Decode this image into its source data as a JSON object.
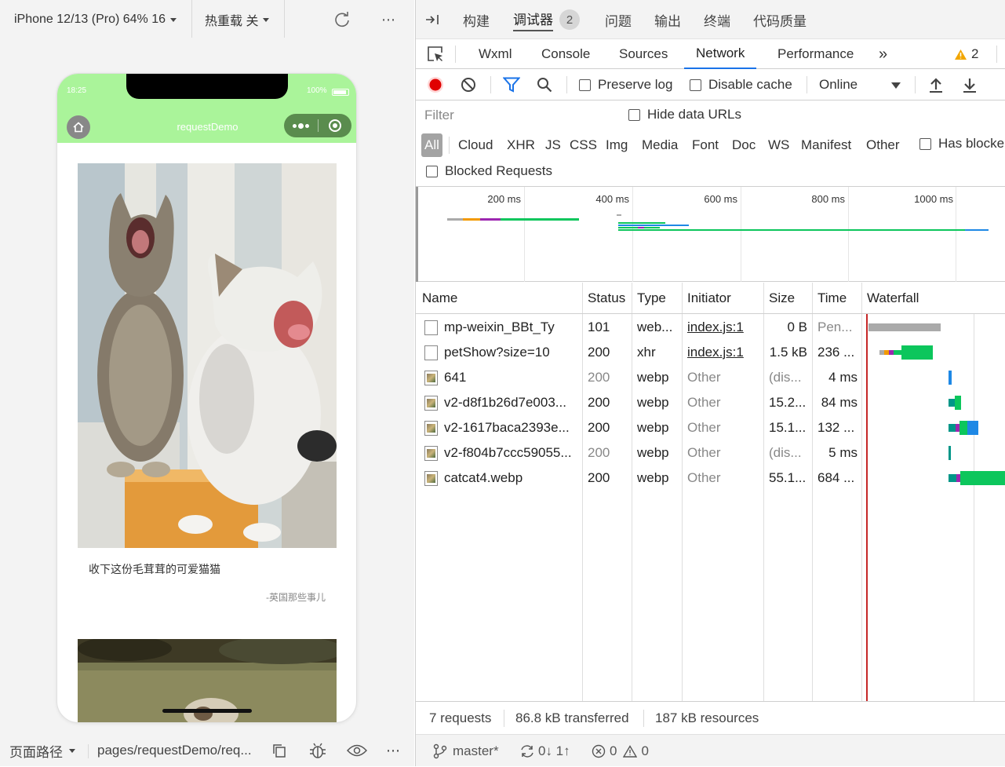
{
  "simulator": {
    "device": "iPhone 12/13 (Pro) 64% 16",
    "hot_reload": "热重载 关",
    "status_time": "18:25",
    "status_battery": "100%",
    "nav_title": "requestDemo",
    "card": {
      "title": "收下这份毛茸茸的可爱猫猫",
      "author": "-英国那些事儿"
    },
    "bottom": {
      "path_label": "页面路径",
      "path_value": "pages/requestDemo/req..."
    }
  },
  "devtools": {
    "top_tabs": [
      "构建",
      "调试器",
      "问题",
      "输出",
      "终端",
      "代码质量"
    ],
    "debugger_badge": "2",
    "panel_tabs": [
      "Wxml",
      "Console",
      "Sources",
      "Network",
      "Performance"
    ],
    "active_panel": "Network",
    "more_tabs": "»",
    "warnings_count": "2",
    "toolbar": {
      "preserve_log": "Preserve log",
      "disable_cache": "Disable cache",
      "throttle": "Online"
    },
    "filter": {
      "placeholder": "Filter",
      "hide_data_urls": "Hide data URLs",
      "types": [
        "All",
        "Cloud",
        "XHR",
        "JS",
        "CSS",
        "Img",
        "Media",
        "Font",
        "Doc",
        "WS",
        "Manifest",
        "Other"
      ],
      "has_blocked": "Has blocke",
      "blocked_requests": "Blocked Requests"
    },
    "overview_ticks": [
      "200 ms",
      "400 ms",
      "600 ms",
      "800 ms",
      "1000 ms"
    ],
    "columns": [
      "Name",
      "Status",
      "Type",
      "Initiator",
      "Size",
      "Time",
      "Waterfall"
    ],
    "requests": [
      {
        "name": "mp-weixin_BBt_Ty",
        "status": "101",
        "type": "web...",
        "initiator": "index.js:1",
        "size": "0 B",
        "time": "Pen...",
        "icon": "blank-doc-icon"
      },
      {
        "name": "petShow?size=10",
        "status": "200",
        "type": "xhr",
        "initiator": "index.js:1",
        "size": "1.5 kB",
        "time": "236 ...",
        "icon": "blank-doc-icon"
      },
      {
        "name": "641",
        "status": "200",
        "type": "webp",
        "initiator": "Other",
        "size": "(dis...",
        "time": "4 ms",
        "icon": "image-thumb-icon"
      },
      {
        "name": "v2-d8f1b26d7e003...",
        "status": "200",
        "type": "webp",
        "initiator": "Other",
        "size": "15.2...",
        "time": "84 ms",
        "icon": "image-thumb-icon"
      },
      {
        "name": "v2-1617baca2393e...",
        "status": "200",
        "type": "webp",
        "initiator": "Other",
        "size": "15.1...",
        "time": "132 ...",
        "icon": "image-thumb-icon"
      },
      {
        "name": "v2-f804b7ccc59055...",
        "status": "200",
        "type": "webp",
        "initiator": "Other",
        "size": "(dis...",
        "time": "5 ms",
        "icon": "image-thumb-icon"
      },
      {
        "name": "catcat4.webp",
        "status": "200",
        "type": "webp",
        "initiator": "Other",
        "size": "55.1...",
        "time": "684 ...",
        "icon": "image-thumb-icon"
      }
    ],
    "summary": {
      "requests": "7 requests",
      "transferred": "86.8 kB transferred",
      "resources": "187 kB resources"
    },
    "git": {
      "branch": "master*",
      "sync": "0↓ 1↑",
      "errors": "0",
      "warnings": "0"
    },
    "colors": {
      "accent": "#1a73e8",
      "record": "#e00000",
      "waterfall_green": "#0cc65c",
      "waterfall_gray": "#aaaaaa",
      "nav_green": "#aaf49a"
    }
  }
}
